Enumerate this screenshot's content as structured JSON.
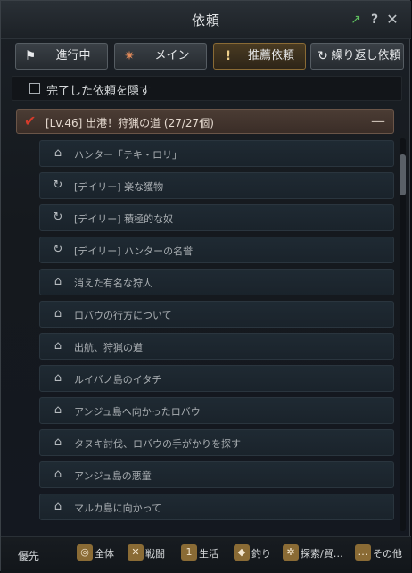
{
  "window": {
    "title": "依頼"
  },
  "titlebar_icons": [
    "external-link-icon",
    "help-icon",
    "close-icon"
  ],
  "tabs": [
    {
      "label": "進行中",
      "icon": "flag-icon",
      "active": false
    },
    {
      "label": "メイン",
      "icon": "compass-star-icon",
      "active": false
    },
    {
      "label": "推薦依頼",
      "icon": "exclamation-icon",
      "active": true
    },
    {
      "label": "繰り返し依頼",
      "icon": "repeat-icon",
      "active": false
    }
  ],
  "hide_completed": {
    "label": "完了した依頼を隠す",
    "checked": false
  },
  "group": {
    "title": "[Lv.46] 出港！狩猟の道 (27/27個)",
    "collapse_symbol": "—"
  },
  "quests": [
    {
      "title": "ハンター「テキ・ロリ」",
      "icon": "house-icon"
    },
    {
      "title": "[デイリー] 楽な獲物",
      "icon": "repeat-icon"
    },
    {
      "title": "[デイリー] 積極的な奴",
      "icon": "repeat-icon"
    },
    {
      "title": "[デイリー] ハンターの名誉",
      "icon": "repeat-icon"
    },
    {
      "title": "消えた有名な狩人",
      "icon": "house-icon"
    },
    {
      "title": "ロバウの行方について",
      "icon": "house-icon"
    },
    {
      "title": "出航、狩猟の道",
      "icon": "house-icon"
    },
    {
      "title": "ルイバノ島のイタチ",
      "icon": "house-icon"
    },
    {
      "title": "アンジュ島へ向かったロバウ",
      "icon": "house-icon"
    },
    {
      "title": "タヌキ討伐、ロバウの手がかりを探す",
      "icon": "house-icon"
    },
    {
      "title": "アンジュ島の悪童",
      "icon": "house-icon"
    },
    {
      "title": "マルカ島に向かって",
      "icon": "house-icon"
    }
  ],
  "footer": {
    "label": "優先",
    "filters": [
      {
        "label": "全体",
        "icon": "all-icon"
      },
      {
        "label": "戦闘",
        "icon": "swords-icon"
      },
      {
        "label": "生活",
        "icon": "life-icon"
      },
      {
        "label": "釣り",
        "icon": "fish-icon"
      },
      {
        "label": "探索/貿…",
        "icon": "wheel-icon"
      },
      {
        "label": "その他",
        "icon": "other-icon"
      }
    ]
  },
  "colors": {
    "accent": "#8a6b35",
    "check": "#d63b2b",
    "external": "#5fbf5f"
  }
}
